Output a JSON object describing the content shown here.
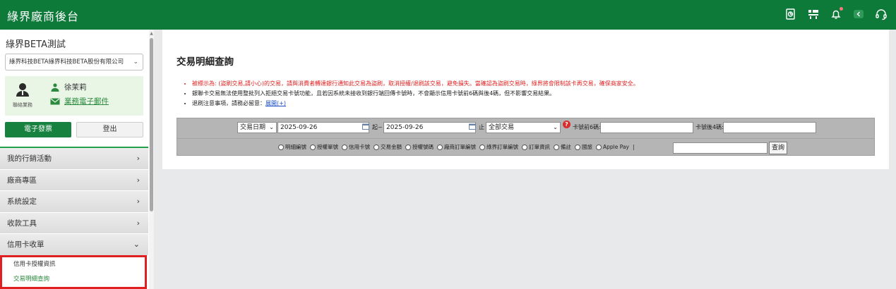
{
  "header": {
    "title": "綠界廠商後台",
    "icons": [
      "document-chart-icon",
      "merchant-icon",
      "bell-icon",
      "back-icon",
      "headset-icon"
    ],
    "colors": {
      "primary": "#0e7a3a",
      "accent": "#22a04c",
      "warning": "#e02020",
      "link": "#1a4fc9"
    }
  },
  "sidebar": {
    "store_name": "綠界BETA測試",
    "company_select": "綠界科技BETA綠界科技BETA股份有限公司",
    "user": {
      "role": "聯絡業務",
      "name": "徐茉莉",
      "link": "業務電子郵件"
    },
    "einvoice_label": "電子發票",
    "logout_label": "登出",
    "menu": [
      {
        "label": "我的行銷活動",
        "arrow": "›"
      },
      {
        "label": "廠商專區",
        "arrow": "›"
      },
      {
        "label": "系統設定",
        "arrow": "›"
      },
      {
        "label": "收款工具",
        "arrow": "›"
      },
      {
        "label": "信用卡收單",
        "arrow": "⌄"
      }
    ],
    "submenu": [
      {
        "label": "信用卡授權資訊"
      },
      {
        "label": "交易明細查詢"
      }
    ]
  },
  "main": {
    "title": "交易明細查詢",
    "notes": {
      "warning": "被標示為: (盜刷交易,請小心)的交易，請與消費者轉達銀行通知此交易為盜刷，取消授權/退刷該交易，避免損失。當確認為盜刷交易時，綠界將會限制該卡再交易，確保商家安全。",
      "debit": "銀聯卡交易無法使用整批列入拒絕交易卡號功能，且若因系統未接收到銀行端回傳卡號時，不會顯示信用卡號前6碼與後4碼，但不影響交易結果。",
      "refund_prefix": "退刷注意事項，請務必留意：",
      "refund_link": "展開(+)"
    },
    "filter": {
      "date_type": "交易日期",
      "date_from": "2025-09-26",
      "from_label": "起~",
      "date_to": "2025-09-26",
      "to_label": "止",
      "trade_type": "全部交易",
      "card_first6_label": "卡號前6碼:",
      "card_first6_value": "",
      "card_last4_label": "卡號後4碼:",
      "card_last4_value": "",
      "radios": [
        "明細編號",
        "授權單號",
        "信用卡號",
        "交易金額",
        "授權號碼",
        "廠商訂單編號",
        "綠界訂單編號",
        "訂單資訊",
        "備註",
        "國旅",
        "Apple Pay"
      ],
      "radio_suffix": "|",
      "search_value": "",
      "query_label": "查詢"
    }
  }
}
